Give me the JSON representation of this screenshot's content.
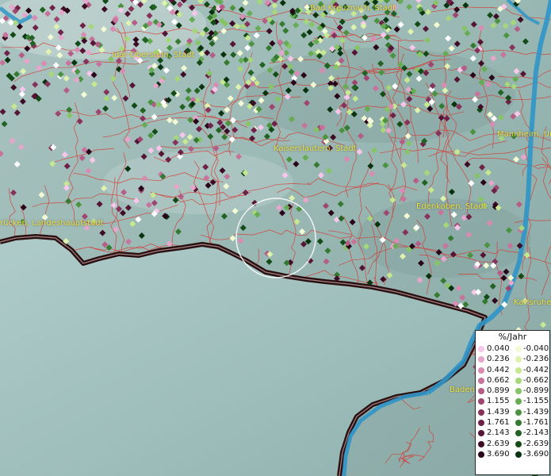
{
  "towns": [
    {
      "name": "Bad Kreuznach, Stadt"
    },
    {
      "name": "Idar-Oberstein, Stadt"
    },
    {
      "name": "Kaiserslautern, Stadt"
    },
    {
      "name": "Mannheim, Un"
    },
    {
      "name": "Edenkoben, Stadt"
    },
    {
      "name": "rücken, Landeshauptstadt"
    },
    {
      "name": "Karlsruhe"
    },
    {
      "name": "Baden"
    }
  ],
  "legend": {
    "title": "%/Jahr",
    "positive": [
      "0.040",
      "0.236",
      "0.442",
      "0.662",
      "0.899",
      "1.155",
      "1.439",
      "1.761",
      "2.143",
      "2.639",
      "3.690"
    ],
    "negative": [
      "-0.040",
      "-0.236",
      "-0.442",
      "-0.662",
      "-0.899",
      "-1.155",
      "-1.439",
      "-1.761",
      "-2.143",
      "-2.639",
      "-3.690"
    ],
    "positive_colors": [
      "#f7c6ea",
      "#e8a5cc",
      "#d98bb3",
      "#c7739c",
      "#b45d86",
      "#9e4670",
      "#86325a",
      "#6e2247",
      "#561535",
      "#3f0c25",
      "#2a0418"
    ],
    "negative_colors": [
      "#f2fbd3",
      "#dff3ae",
      "#c6e88f",
      "#a6d77a",
      "#86c466",
      "#66ac52",
      "#4c9340",
      "#357a31",
      "#226223",
      "#134b17",
      "#08330e"
    ]
  }
}
